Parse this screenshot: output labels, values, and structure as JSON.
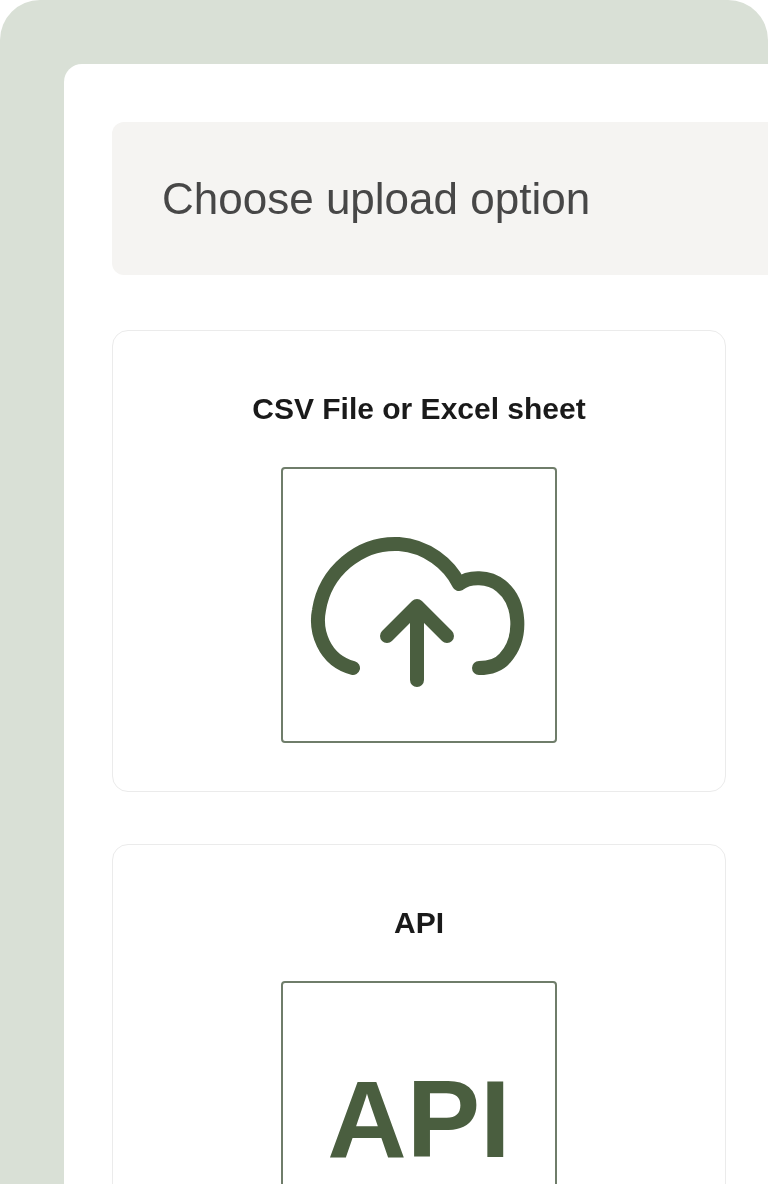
{
  "header": {
    "title": "Choose upload option"
  },
  "options": [
    {
      "kind": "upload",
      "title": "CSV File or Excel sheet"
    },
    {
      "kind": "api",
      "title": "API",
      "tile_text": "API"
    }
  ]
}
